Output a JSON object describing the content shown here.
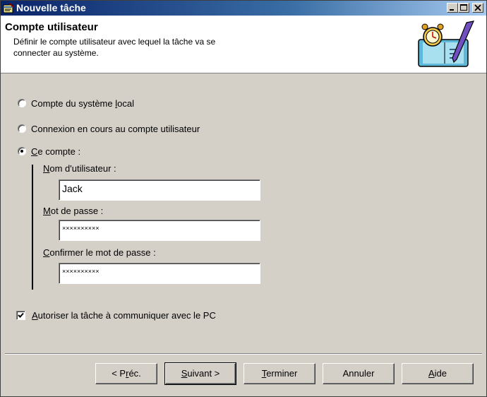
{
  "window": {
    "title": "Nouvelle tâche",
    "title_bar_color": "#0a246a",
    "controls": [
      "minimize-icon",
      "maximize-icon",
      "close-icon"
    ]
  },
  "header": {
    "title": "Compte utilisateur",
    "subtitle_line1": "Définir le compte utilisateur avec lequel la tâche va se",
    "subtitle_line2": "connecter au système."
  },
  "options": {
    "local_pre": "Compte du système ",
    "local_u": "l",
    "local_post": "ocal",
    "current_label": "Connexion en cours au compte utilisateur",
    "this_u": "C",
    "this_post": "e compte :",
    "selected": "this_account"
  },
  "fields": {
    "username_u": "N",
    "username_post": "om d'utilisateur :",
    "username_value": "Jack",
    "password_u": "M",
    "password_post": "ot de passe :",
    "password_value": "××××××××××",
    "confirm_u": "C",
    "confirm_post": "onfirmer le mot de passe :",
    "confirm_value": "××××××××××"
  },
  "checkbox": {
    "u": "A",
    "post": "utoriser la tâche à communiquer avec le PC",
    "checked": true
  },
  "buttons": {
    "prev_pre": "< P",
    "prev_u": "r",
    "prev_post": "éc.",
    "next_u": "S",
    "next_post": "uivant >",
    "finish_u": "T",
    "finish_post": "erminer",
    "cancel": "Annuler",
    "help_u": "A",
    "help_post": "ide"
  }
}
